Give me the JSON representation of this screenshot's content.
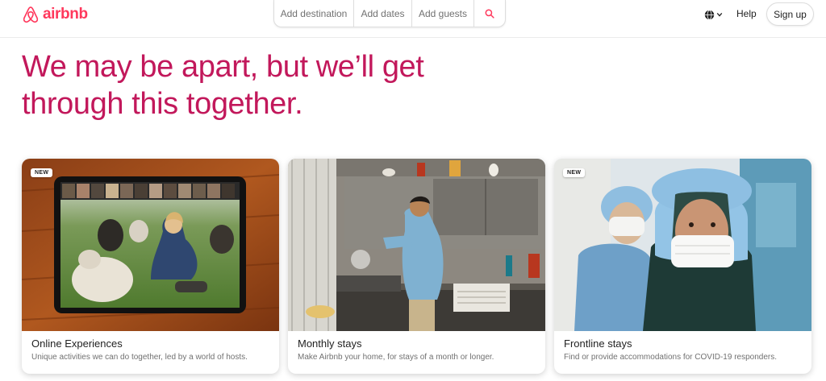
{
  "brand": {
    "name": "airbnb",
    "color": "#ff385c"
  },
  "search": {
    "destination_placeholder": "Add destination",
    "dates_placeholder": "Add dates",
    "guests_placeholder": "Add guests",
    "icon": "search-icon"
  },
  "header": {
    "language_icon": "globe-icon",
    "help_label": "Help",
    "signup_label": "Sign up"
  },
  "hero": {
    "line1": "We may be apart, but we’ll get",
    "line2": "through this together.",
    "color": "#c2185b"
  },
  "cards": [
    {
      "badge": "NEW",
      "title": "Online Experiences",
      "subtitle": "Unique activities we can do together, led by a world of hosts."
    },
    {
      "badge": "",
      "title": "Monthly stays",
      "subtitle": "Make Airbnb your home, for stays of a month or longer."
    },
    {
      "badge": "NEW",
      "title": "Frontline stays",
      "subtitle": "Find or provide accommodations for COVID-19 responders."
    }
  ]
}
